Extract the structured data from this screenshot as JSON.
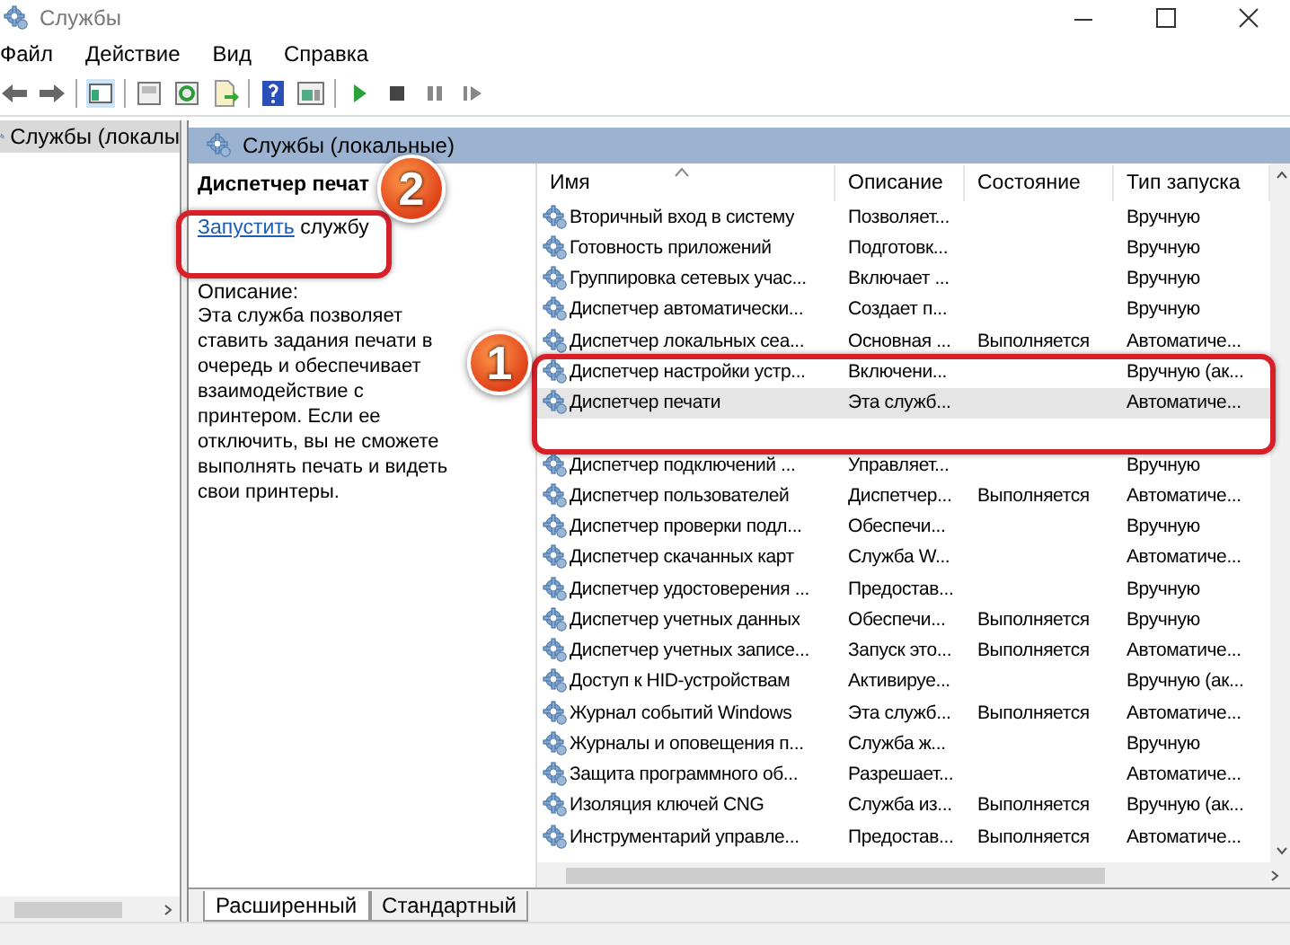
{
  "window": {
    "title": "Службы"
  },
  "menu": [
    "Файл",
    "Действие",
    "Вид",
    "Справка"
  ],
  "tree": {
    "items": [
      {
        "label": "Службы (локалы",
        "selected": true
      }
    ]
  },
  "pane": {
    "title": "Службы (локальные)"
  },
  "details": {
    "service_name": "Диспетчер печат",
    "action_link": "Запустить",
    "action_text": "службу",
    "description_label": "Описание:",
    "description": "Эта служба позволяет ставить задания печати в очередь и обеспечивает взаимодействие с принтером. Если ее отключить, вы не сможете выполнять печать и видеть свои принтеры."
  },
  "table": {
    "columns": [
      "Имя",
      "Описание",
      "Состояние",
      "Тип запуска"
    ],
    "rows": [
      {
        "kind": "service",
        "name": "Вторичный вход в систему",
        "description": "Позволяет...",
        "state": "",
        "startup": "Вручную",
        "selected": false
      },
      {
        "kind": "service",
        "name": "Готовность приложений",
        "description": "Подготовк...",
        "startup": "Вручную",
        "selected": false
      },
      {
        "kind": "service",
        "name": "Группировка сетевых учас...",
        "description": "Включает ...",
        "startup": "Вручную",
        "selected": false
      },
      {
        "kind": "service",
        "name": "Диспетчер автоматически...",
        "description": "Создает п...",
        "startup": "Вручную",
        "selected": false
      },
      {
        "kind": "service",
        "name": "Диспетчер локальных сеа...",
        "description": "Основная ...",
        "state": "Выполняется",
        "startup": "Автоматиче...",
        "selected": false
      },
      {
        "kind": "service",
        "name": "Диспетчер настройки устр...",
        "description": "Включени...",
        "startup": "Вручную (ак...",
        "selected": false
      },
      {
        "kind": "service",
        "name": "Диспетчер печати",
        "description": "Эта служб...",
        "startup": "Автоматиче...",
        "selected": true
      },
      {
        "kind": "obscured"
      },
      {
        "kind": "service",
        "name": "Диспетчер подключений ...",
        "description": "Управляет...",
        "startup": "Вручную",
        "selected": false
      },
      {
        "kind": "service",
        "name": "Диспетчер пользователей",
        "description": "Диспетчер...",
        "state": "Выполняется",
        "startup": "Автоматиче...",
        "selected": false
      },
      {
        "kind": "service",
        "name": "Диспетчер проверки подл...",
        "description": "Обеспечи...",
        "startup": "Вручную",
        "selected": false
      },
      {
        "kind": "service",
        "name": "Диспетчер скачанных карт",
        "description": "Служба W...",
        "startup": "Автоматиче...",
        "selected": false
      },
      {
        "kind": "service",
        "name": "Диспетчер удостоверения ...",
        "description": "Предостав...",
        "startup": "Вручную",
        "selected": false
      },
      {
        "kind": "service",
        "name": "Диспетчер учетных данных",
        "description": "Обеспечи...",
        "state": "Выполняется",
        "startup": "Вручную",
        "selected": false
      },
      {
        "kind": "service",
        "name": "Диспетчер учетных записе...",
        "description": "Запуск это...",
        "state": "Выполняется",
        "startup": "Автоматиче...",
        "selected": false
      },
      {
        "kind": "service",
        "name": "Доступ к HID-устройствам",
        "description": "Активируе...",
        "startup": "Вручную (ак...",
        "selected": false
      },
      {
        "kind": "service",
        "name": "Журнал событий Windows",
        "description": "Эта служб...",
        "state": "Выполняется",
        "startup": "Автоматиче...",
        "selected": false
      },
      {
        "kind": "service",
        "name": "Журналы и оповещения п...",
        "description": "Служба ж...",
        "startup": "Вручную",
        "selected": false
      },
      {
        "kind": "service",
        "name": "Защита программного об...",
        "description": "Разрешает...",
        "startup": "Автоматиче...",
        "selected": false
      },
      {
        "kind": "service",
        "name": "Изоляция ключей CNG",
        "description": "Служба из...",
        "state": "Выполняется",
        "startup": "Вручную (ак...",
        "selected": false
      },
      {
        "kind": "service",
        "name": "Инструментарий управле...",
        "description": "Предостав...",
        "state": "Выполняется",
        "startup": "Автоматиче...",
        "selected": false
      }
    ]
  },
  "tabs": [
    {
      "label": "Расширенный",
      "selected": true
    },
    {
      "label": "Стандартный",
      "selected": false
    }
  ],
  "annotations": [
    {
      "number": "1"
    },
    {
      "number": "2"
    }
  ]
}
